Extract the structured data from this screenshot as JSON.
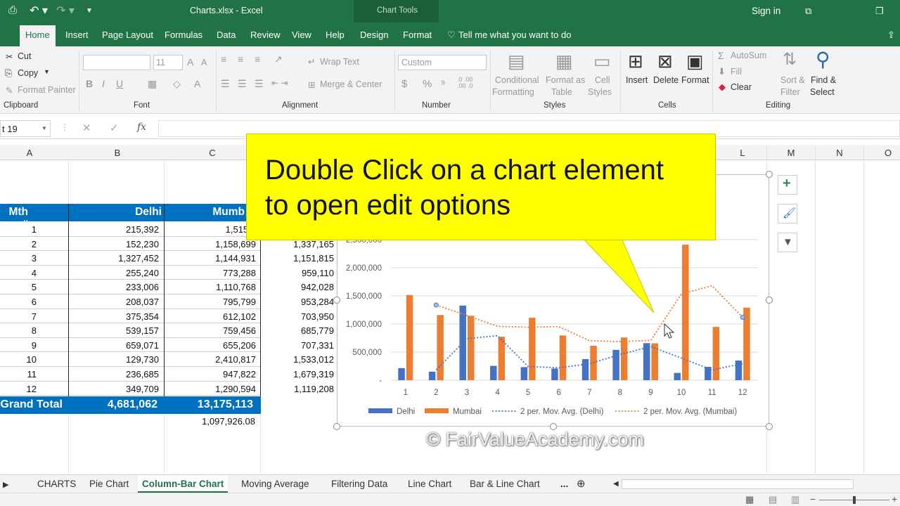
{
  "titlebar": {
    "title": "Charts.xlsx  -  Excel",
    "context_tab": "Chart Tools",
    "signin": "Sign in"
  },
  "tabs": {
    "home": "Home",
    "insert": "Insert",
    "page_layout": "Page Layout",
    "formulas": "Formulas",
    "data": "Data",
    "review": "Review",
    "view": "View",
    "help": "Help",
    "design": "Design",
    "format": "Format",
    "tell_me": "Tell me what you want to do"
  },
  "ribbon": {
    "clipboard": {
      "cut": "Cut",
      "copy": "Copy",
      "format_painter": "Format Painter",
      "group": "Clipboard"
    },
    "font": {
      "size": "11",
      "group": "Font"
    },
    "alignment": {
      "wrap": "Wrap Text",
      "merge": "Merge & Center",
      "group": "Alignment"
    },
    "number": {
      "format": "Custom",
      "group": "Number"
    },
    "styles": {
      "cond1": "Conditional",
      "cond2": "Formatting",
      "fmt1": "Format as",
      "fmt2": "Table",
      "cell1": "Cell",
      "cell2": "Styles",
      "group": "Styles"
    },
    "cells": {
      "insert": "Insert",
      "delete": "Delete",
      "format": "Format",
      "group": "Cells"
    },
    "editing": {
      "autosum": "AutoSum",
      "fill": "Fill",
      "clear": "Clear",
      "sort1": "Sort &",
      "sort2": "Filter",
      "find1": "Find &",
      "find2": "Select",
      "group": "Editing"
    }
  },
  "formula_bar": {
    "name_box": "t 19",
    "fx": "fx"
  },
  "columns": [
    "A",
    "B",
    "C",
    "L",
    "M",
    "N",
    "O"
  ],
  "table": {
    "headers": [
      "Mth #",
      "Delhi",
      "Mumb"
    ],
    "rows": [
      [
        "1",
        "215,392",
        "1,515,6",
        ""
      ],
      [
        "2",
        "152,230",
        "1,158,699",
        "1,337,165"
      ],
      [
        "3",
        "1,327,452",
        "1,144,931",
        "1,151,815"
      ],
      [
        "4",
        "255,240",
        "773,288",
        "959,110"
      ],
      [
        "5",
        "233,006",
        "1,110,768",
        "942,028"
      ],
      [
        "6",
        "208,037",
        "795,799",
        "953,284"
      ],
      [
        "7",
        "375,354",
        "612,102",
        "703,950"
      ],
      [
        "8",
        "539,157",
        "759,456",
        "685,779"
      ],
      [
        "9",
        "659,071",
        "655,206",
        "707,331"
      ],
      [
        "10",
        "129,730",
        "2,410,817",
        "1,533,012"
      ],
      [
        "11",
        "236,685",
        "947,822",
        "1,679,319"
      ],
      [
        "12",
        "349,709",
        "1,290,594",
        "1,119,208"
      ]
    ],
    "grand_total": [
      "Grand Total",
      "4,681,062",
      "13,175,113"
    ],
    "extra": "1,097,926.08"
  },
  "callout": {
    "line1": "Double Click on a chart element",
    "line2": "to open edit options"
  },
  "chart_data": {
    "type": "bar",
    "categories": [
      "1",
      "2",
      "3",
      "4",
      "5",
      "6",
      "7",
      "8",
      "9",
      "10",
      "11",
      "12"
    ],
    "series": [
      {
        "name": "Delhi",
        "values": [
          215392,
          152230,
          1327452,
          255240,
          233006,
          208037,
          375354,
          539157,
          659071,
          129730,
          236685,
          349709
        ],
        "color": "#4472c4"
      },
      {
        "name": "Mumbai",
        "values": [
          1515630,
          1158699,
          1144931,
          773288,
          1110768,
          795799,
          612102,
          759456,
          655206,
          2410817,
          947822,
          1290594
        ],
        "color": "#ed7d31"
      }
    ],
    "moving_averages": [
      {
        "name": "2 per. Mov. Avg. (Delhi)",
        "color": "#4472c4"
      },
      {
        "name": "2 per. Mov. Avg. (Mumbai)",
        "color": "#ed7d31"
      }
    ],
    "ylim": [
      0,
      2500000
    ],
    "yticks": [
      "-",
      "500,000",
      "1,000,000",
      "1,500,000",
      "2,000,000"
    ],
    "partial_tick": "2,500,000",
    "legend_position": "bottom"
  },
  "sheet_tabs": [
    "CHARTS",
    "Pie Chart",
    "Column-Bar Chart",
    "Moving Average",
    "Filtering Data",
    "Line Chart",
    "Bar & Line Chart",
    "..."
  ],
  "watermark": "© FairValueAcademy.com"
}
